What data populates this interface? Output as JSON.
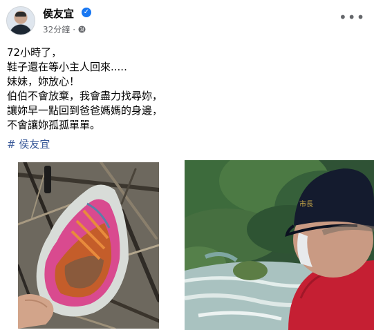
{
  "author": {
    "name": "侯友宜",
    "verified_icon": "verified-badge-icon",
    "time": "32分鐘",
    "privacy_icon": "globe-icon"
  },
  "menu": {
    "more_icon": "more-options-icon",
    "more_label": "•••"
  },
  "post": {
    "lines": [
      "72小時了，",
      "鞋子還在等小主人回來.....",
      "妹妹，妳放心！",
      "伯伯不會放棄，我會盡力找尋妳，",
      "讓妳早一點回到爸爸媽媽的身邊，",
      "不會讓妳孤孤單單。"
    ],
    "hashtag": "# 侯友宜"
  },
  "photos": {
    "left_alt": "photo-shoe-in-debris",
    "right_alt": "photo-man-in-cap-by-river",
    "cap_text": "市長"
  },
  "colors": {
    "link": "#385898",
    "verified": "#1877f2",
    "meta": "#65676b",
    "jacket": "#c51f33",
    "cap": "#141b2e"
  }
}
